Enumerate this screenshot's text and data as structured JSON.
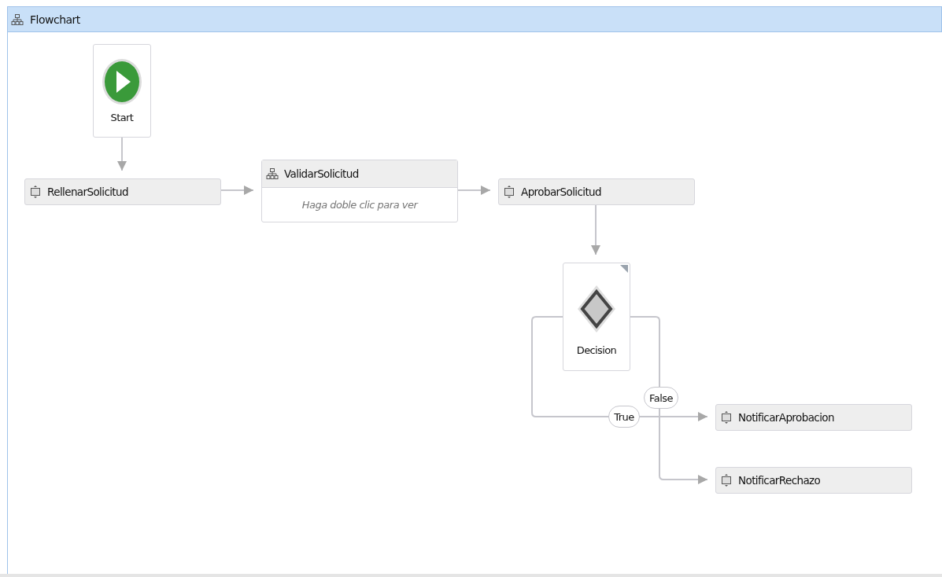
{
  "window": {
    "title": "Flowchart"
  },
  "nodes": [
    {
      "kind": "start",
      "label": "Start"
    },
    {
      "kind": "activity",
      "label": "RellenarSolicitud"
    },
    {
      "kind": "flowchart",
      "label": "ValidarSolicitud",
      "hint": "Haga doble clic para ver"
    },
    {
      "kind": "activity",
      "label": "AprobarSolicitud"
    },
    {
      "kind": "decision",
      "label": "Decision"
    },
    {
      "kind": "activity",
      "label": "NotificarAprobacion"
    },
    {
      "kind": "activity",
      "label": "NotificarRechazo"
    }
  ],
  "branches": [
    {
      "label": "True"
    },
    {
      "label": "False"
    }
  ]
}
